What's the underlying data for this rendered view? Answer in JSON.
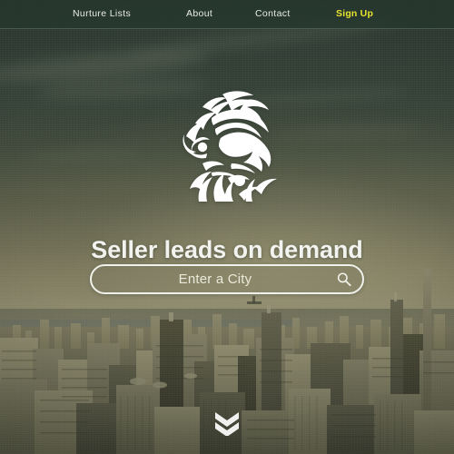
{
  "page": {
    "title": "Seller leads on demand",
    "background_description": "aerial cityscape photo with green sepia overlay"
  },
  "nav": {
    "items": [
      {
        "label": "Nurture Lists",
        "name": "nav-item-nurture-lists",
        "accent": false
      },
      {
        "label": "About",
        "name": "nav-item-about",
        "accent": false
      },
      {
        "label": "Contact",
        "name": "nav-item-contact",
        "accent": false
      },
      {
        "label": "Sign Up",
        "name": "nav-item-sign-up",
        "accent": true
      }
    ]
  },
  "logo": {
    "icon": "lion-head-icon",
    "alt": "Lion head logo"
  },
  "hero": {
    "headline": "Seller leads on demand"
  },
  "search": {
    "value": "",
    "placeholder": "Enter a City",
    "icon": "search-icon"
  },
  "scroll_cue": {
    "icon": "double-chevron-down-icon"
  },
  "colors": {
    "accent": "#e8e32e",
    "nav_text": "#e7ebe3",
    "headline": "#f2f3ef",
    "search_border": "#f0f1ea",
    "overlay": "#3c4a3e"
  }
}
